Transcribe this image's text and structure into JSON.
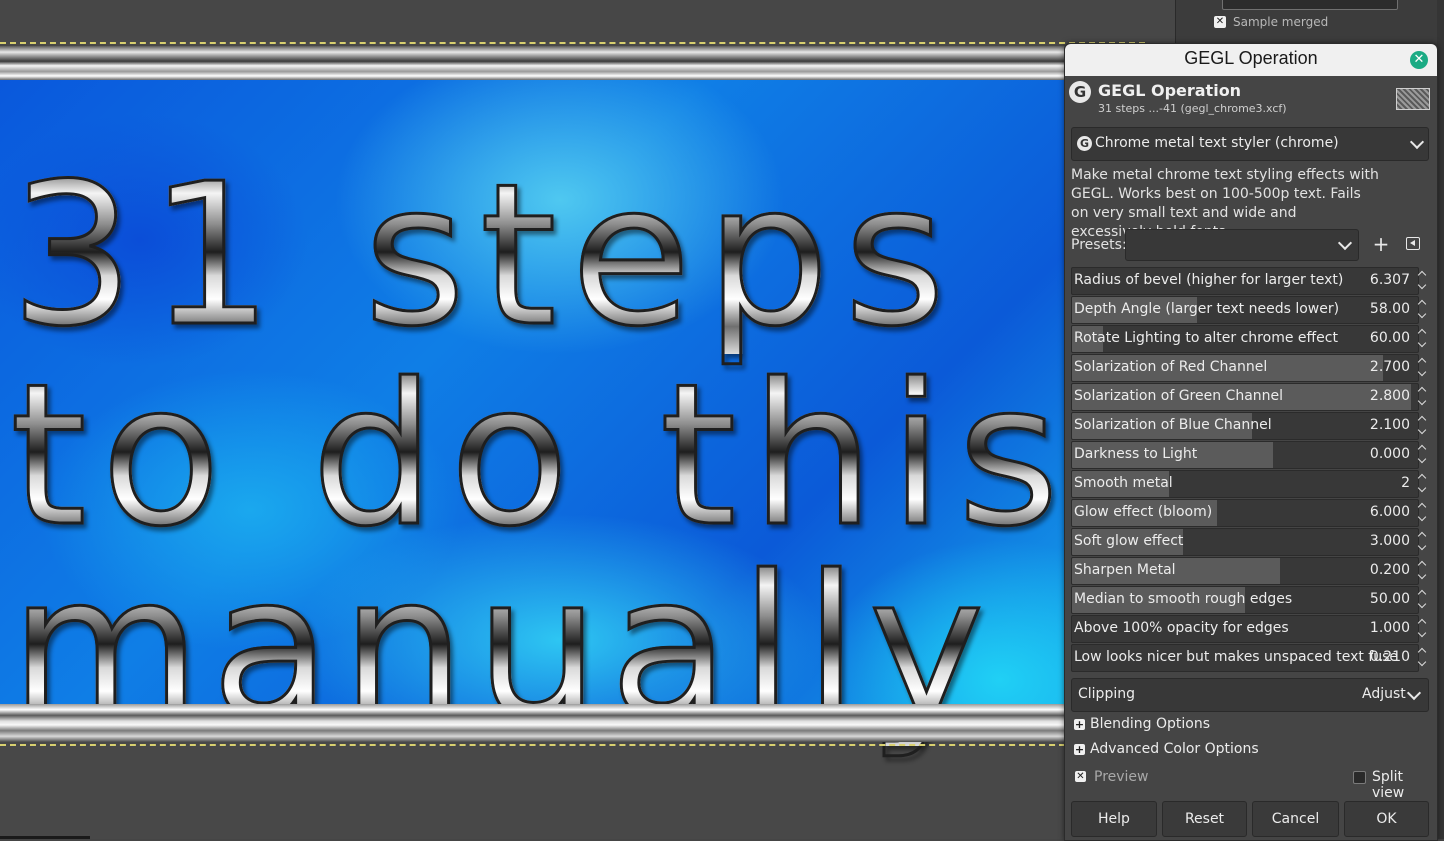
{
  "dock": {
    "sample_merged_label": "Sample merged",
    "sample_merged_checked": true
  },
  "canvas": {
    "text_lines": [
      "31 steps",
      "to do this",
      "manually"
    ]
  },
  "dialog": {
    "window_title": "GEGL Operation",
    "header_title": "GEGL Operation",
    "header_subtitle": "31 steps ...-41 (gegl_chrome3.xcf)",
    "logo_glyph": "G",
    "operation_label": "Chrome metal text styler (chrome)",
    "description": "Make metal chrome text styling effects with GEGL. Works best on 100-500p text. Fails on very small text and wide and excessively bold fonts.",
    "presets_label": "Presets:",
    "presets_value": "",
    "add_preset_glyph": "+",
    "params": [
      {
        "label": "Radius of bevel (higher for larger text)",
        "value": "6.307",
        "fill": 0.0
      },
      {
        "label": "Depth Angle (larger text needs lower)",
        "value": "58.00",
        "fill": 0.36
      },
      {
        "label": "Rotate Lighting to alter chrome effect",
        "value": "60.00",
        "fill": 0.09
      },
      {
        "label": "Solarization of Red Channel",
        "value": "2.700",
        "fill": 0.9
      },
      {
        "label": "Solarization of Green Channel",
        "value": "2.800",
        "fill": 0.98
      },
      {
        "label": "Solarization of Blue Channel",
        "value": "2.100",
        "fill": 0.52
      },
      {
        "label": "Darkness to Light",
        "value": "0.000",
        "fill": 0.58
      },
      {
        "label": "Smooth metal",
        "value": "2",
        "fill": 0.28
      },
      {
        "label": "Glow effect (bloom)",
        "value": "6.000",
        "fill": 0.42
      },
      {
        "label": "Soft glow effect",
        "value": "3.000",
        "fill": 0.32
      },
      {
        "label": "Sharpen Metal",
        "value": "0.200",
        "fill": 0.6
      },
      {
        "label": "Median to smooth rough edges",
        "value": "50.00",
        "fill": 0.5
      },
      {
        "label": "Above 100% opacity for edges",
        "value": "1.000",
        "fill": 0.0
      },
      {
        "label": "Low looks nicer but makes unspaced text fuse",
        "value": "0.210",
        "fill": 0.0
      }
    ],
    "clipping_label": "Clipping",
    "clipping_value": "Adjust",
    "blending_options": "Blending Options",
    "advanced_color_options": "Advanced Color Options",
    "preview_label": "Preview",
    "preview_checked": true,
    "split_view_label": "Split view",
    "split_view_checked": false,
    "buttons": {
      "help": "Help",
      "reset": "Reset",
      "cancel": "Cancel",
      "ok": "OK"
    }
  },
  "colors": {
    "accent_close": "#1bab84",
    "selection_dash": "#d8d070",
    "canvas_blue": "#0f7ee6"
  }
}
